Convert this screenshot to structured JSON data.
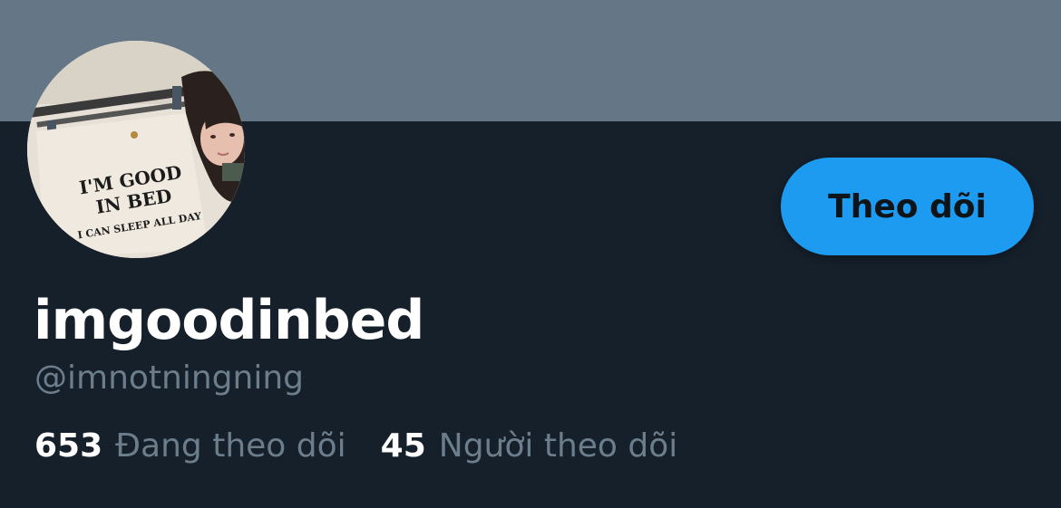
{
  "profile": {
    "display_name": "imgoodinbed",
    "handle": "@imnotningning",
    "avatar": {
      "shirt_text_line1": "I'M GOOD",
      "shirt_text_line2": "IN BED",
      "shirt_text_line3": "I CAN SLEEP ALL DAY"
    }
  },
  "actions": {
    "follow_label": "Theo dõi"
  },
  "stats": {
    "following_count": "653",
    "following_label": "Đang theo dõi",
    "followers_count": "45",
    "followers_label": "Người theo dõi"
  },
  "colors": {
    "banner": "#657787",
    "background": "#16202b",
    "accent": "#1d9bf0",
    "muted_text": "#6c7d8c",
    "primary_text": "#ffffff"
  }
}
